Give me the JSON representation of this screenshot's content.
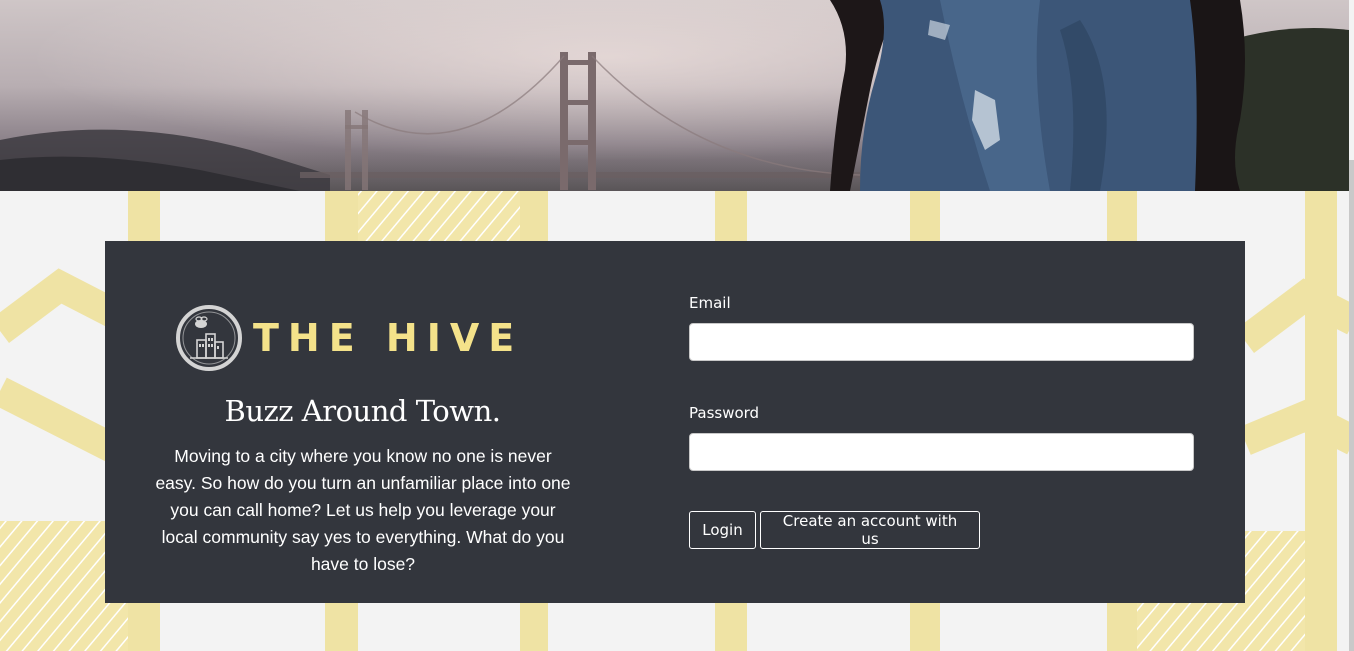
{
  "brand": {
    "name": "THE HIVE",
    "accent_color": "#f4e28a",
    "logo_icon": "hive-city-bee-logo-icon"
  },
  "intro": {
    "tagline": "Buzz Around Town.",
    "blurb": "Moving to a city where you know no one is never easy. So how do you turn an unfamiliar place into one you can call home? Let us help you leverage your local community say yes to everything. What do you have to lose?"
  },
  "login_form": {
    "email_label": "Email",
    "email_value": "",
    "password_label": "Password",
    "password_value": "",
    "login_button": "Login",
    "create_account_button": "Create an account with us"
  },
  "colors": {
    "card_background": "#33363d",
    "pattern_yellow": "#efe3a4",
    "page_background": "#f3f3f3"
  }
}
